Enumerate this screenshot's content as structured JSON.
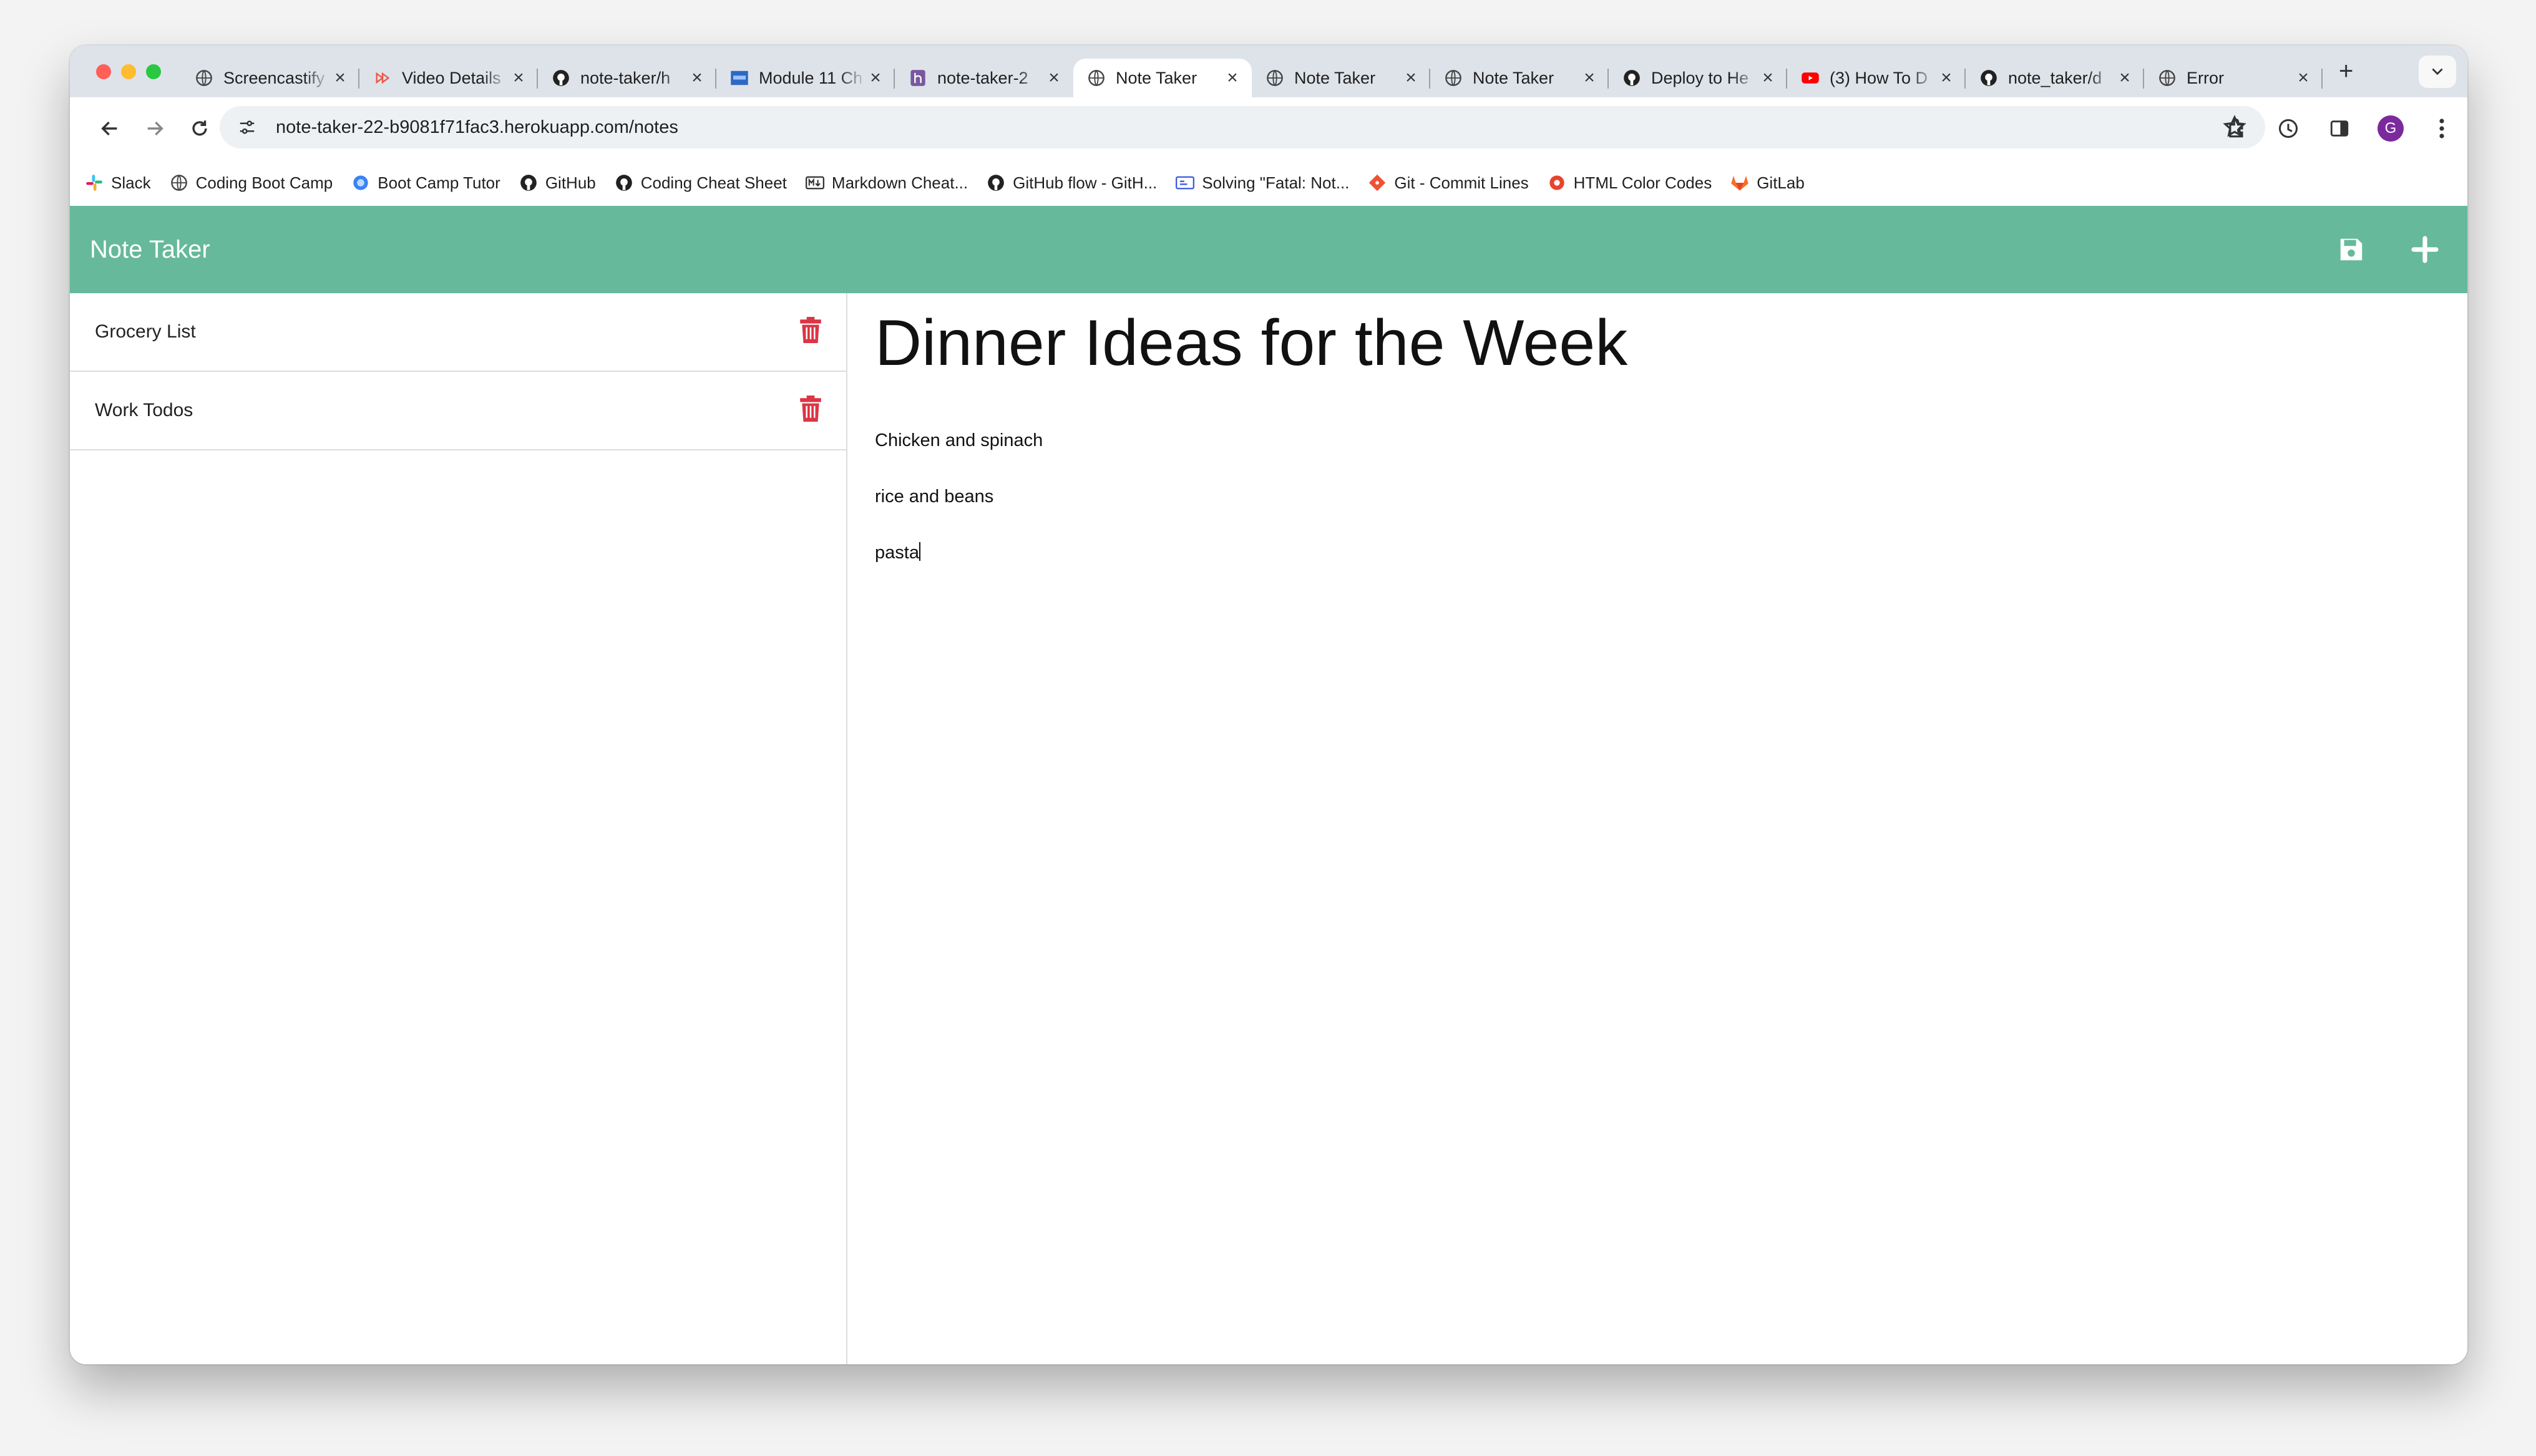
{
  "browser": {
    "tabs": [
      {
        "title": "Screencastify",
        "icon": "globe-icon",
        "active": false
      },
      {
        "title": "Video Details",
        "icon": "video-icon",
        "active": false
      },
      {
        "title": "note-taker/h",
        "icon": "github-icon",
        "active": false
      },
      {
        "title": "Module 11 Ch",
        "icon": "ucla-icon",
        "active": false
      },
      {
        "title": "note-taker-2",
        "icon": "heroku-icon",
        "active": false
      },
      {
        "title": "Note Taker",
        "icon": "globe-icon",
        "active": true
      },
      {
        "title": "Note Taker",
        "icon": "globe-icon",
        "active": false
      },
      {
        "title": "Note Taker",
        "icon": "globe-icon",
        "active": false
      },
      {
        "title": "Deploy to He",
        "icon": "github-icon",
        "active": false
      },
      {
        "title": "(3) How To D",
        "icon": "youtube-icon",
        "active": false
      },
      {
        "title": "note_taker/d",
        "icon": "github-icon",
        "active": false
      },
      {
        "title": "Error",
        "icon": "globe-icon",
        "active": false
      }
    ],
    "url": "note-taker-22-b9081f71fac3.herokuapp.com/notes",
    "profile_initial": "G",
    "bookmarks": [
      {
        "label": "Slack",
        "icon": "slack-icon"
      },
      {
        "label": "Coding Boot Camp",
        "icon": "globe-icon"
      },
      {
        "label": "Boot Camp Tutor",
        "icon": "circle-blue-icon"
      },
      {
        "label": "GitHub",
        "icon": "github-icon"
      },
      {
        "label": "Coding Cheat Sheet",
        "icon": "github-icon"
      },
      {
        "label": "Markdown Cheat...",
        "icon": "markdown-icon"
      },
      {
        "label": "GitHub flow - GitH...",
        "icon": "github-icon"
      },
      {
        "label": "Solving \"Fatal: Not...",
        "icon": "window-icon"
      },
      {
        "label": "Git - Commit Lines",
        "icon": "git-icon"
      },
      {
        "label": "HTML Color Codes",
        "icon": "html-color-icon"
      },
      {
        "label": "GitLab",
        "icon": "gitlab-icon"
      }
    ]
  },
  "app": {
    "brand": "Note Taker",
    "accent_color": "#66b99b",
    "delete_color": "#dc3545",
    "notes": [
      {
        "title": "Grocery List"
      },
      {
        "title": "Work Todos"
      }
    ],
    "active_note": {
      "title": "Dinner Ideas for the Week",
      "body_lines": [
        "Chicken and spinach",
        "rice and beans",
        "pasta"
      ]
    }
  }
}
